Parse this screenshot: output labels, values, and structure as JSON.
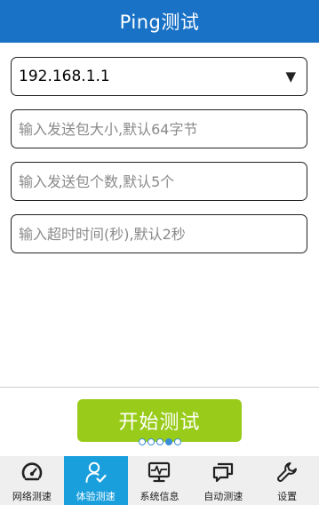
{
  "header": {
    "title": "Ping测试"
  },
  "form": {
    "host_select": {
      "value": "192.168.1.1",
      "arrow": "▼"
    },
    "packet_size": {
      "placeholder": "输入发送包大小,默认64字节",
      "value": ""
    },
    "packet_count": {
      "placeholder": "输入发送包个数,默认5个",
      "value": ""
    },
    "timeout": {
      "placeholder": "输入超时时间(秒),默认2秒",
      "value": ""
    }
  },
  "start_button": {
    "label": "开始测试"
  },
  "pager": {
    "count": 5,
    "active_index": 3
  },
  "nav": {
    "items": [
      {
        "label": "网络测速",
        "icon": "speedometer-icon"
      },
      {
        "label": "体验测速",
        "icon": "user-check-icon",
        "active": true
      },
      {
        "label": "系统信息",
        "icon": "monitor-pulse-icon"
      },
      {
        "label": "自动测速",
        "icon": "chat-bubbles-icon"
      },
      {
        "label": "设置",
        "icon": "wrench-icon"
      }
    ]
  },
  "colors": {
    "header": "#1a72c6",
    "start_button": "#99cc1a",
    "nav_active": "#1a9fdd",
    "pager_dot": "#3b8fd6"
  }
}
